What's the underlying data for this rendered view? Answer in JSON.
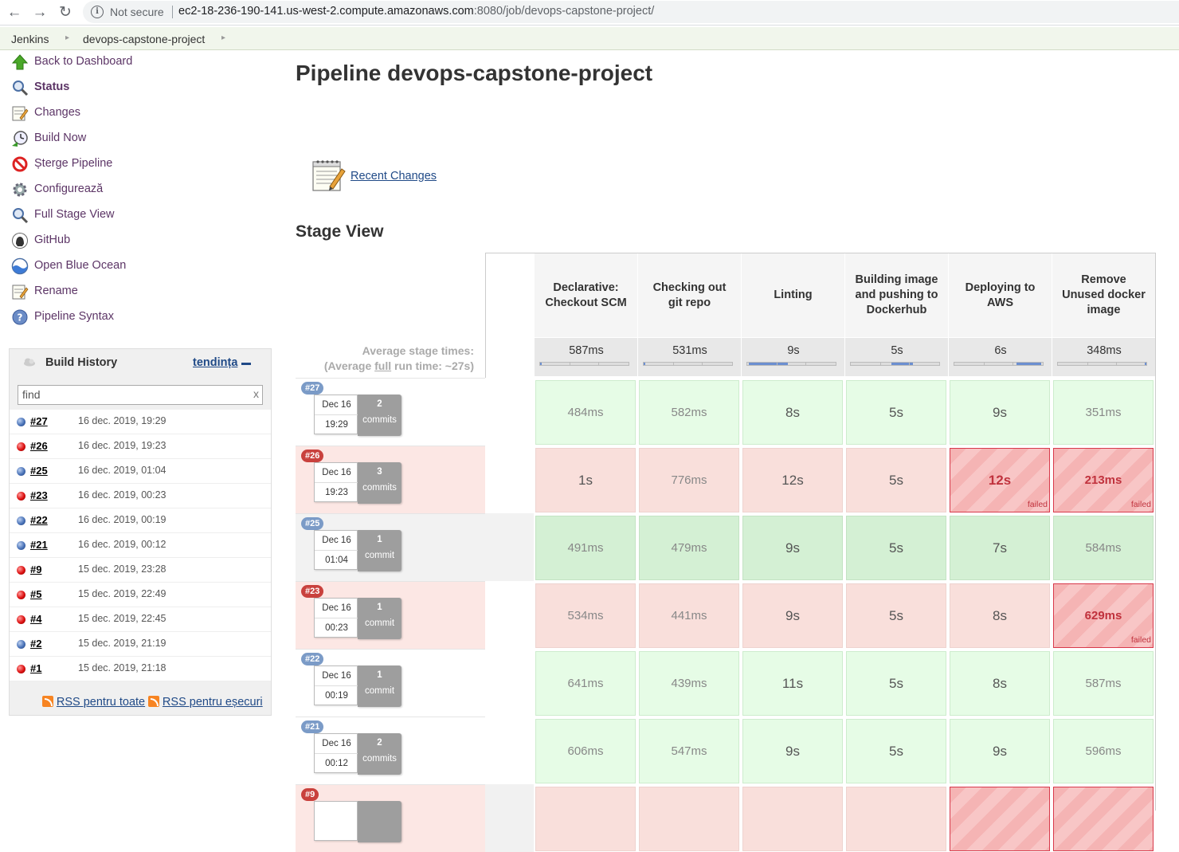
{
  "browser": {
    "security_label": "Not secure",
    "url_host": "ec2-18-236-190-141.us-west-2.compute.amazonaws.com",
    "url_rest": ":8080/job/devops-capstone-project/"
  },
  "breadcrumb": {
    "items": [
      "Jenkins",
      "devops-capstone-project"
    ]
  },
  "sidebar": {
    "tasks": [
      {
        "label": "Back to Dashboard",
        "icon": "up-arrow-icon"
      },
      {
        "label": "Status",
        "icon": "search-icon"
      },
      {
        "label": "Changes",
        "icon": "notepad-icon"
      },
      {
        "label": "Build Now",
        "icon": "clock-icon"
      },
      {
        "label": "Șterge Pipeline",
        "icon": "no-entry-icon"
      },
      {
        "label": "Configurează",
        "icon": "gear-icon"
      },
      {
        "label": "Full Stage View",
        "icon": "search-icon"
      },
      {
        "label": "GitHub",
        "icon": "github-icon"
      },
      {
        "label": "Open Blue Ocean",
        "icon": "blue-ocean-icon"
      },
      {
        "label": "Rename",
        "icon": "notepad-icon"
      },
      {
        "label": "Pipeline Syntax",
        "icon": "help-icon"
      }
    ]
  },
  "build_history": {
    "title": "Build History",
    "trend_label": "tendința",
    "filter_placeholder": "find",
    "clear_label": "x",
    "builds": [
      {
        "number": "#27",
        "date": "16 dec. 2019, 19:29",
        "status": "blue"
      },
      {
        "number": "#26",
        "date": "16 dec. 2019, 19:23",
        "status": "red"
      },
      {
        "number": "#25",
        "date": "16 dec. 2019, 01:04",
        "status": "blue"
      },
      {
        "number": "#23",
        "date": "16 dec. 2019, 00:23",
        "status": "red"
      },
      {
        "number": "#22",
        "date": "16 dec. 2019, 00:19",
        "status": "blue"
      },
      {
        "number": "#21",
        "date": "16 dec. 2019, 00:12",
        "status": "blue"
      },
      {
        "number": "#9",
        "date": "15 dec. 2019, 23:28",
        "status": "red"
      },
      {
        "number": "#5",
        "date": "15 dec. 2019, 22:49",
        "status": "red"
      },
      {
        "number": "#4",
        "date": "15 dec. 2019, 22:45",
        "status": "red"
      },
      {
        "number": "#2",
        "date": "15 dec. 2019, 21:19",
        "status": "blue"
      },
      {
        "number": "#1",
        "date": "15 dec. 2019, 21:18",
        "status": "red"
      }
    ],
    "rss_all": "RSS pentru toate",
    "rss_failures": "RSS pentru eșecuri"
  },
  "main": {
    "title": "Pipeline devops-capstone-project",
    "recent_changes": "Recent Changes",
    "stage_view_title": "Stage View",
    "avg_label_line1": "Average stage times:",
    "avg_label_line2_pre": "(Average ",
    "avg_label_line2_full": "full",
    "avg_label_line2_post": " run time: ~27s)"
  },
  "stage_view": {
    "stages": [
      {
        "name": "Declarative: Checkout SCM",
        "avg": "587ms",
        "avg_fill": [
          0.0,
          0.02
        ]
      },
      {
        "name": "Checking out git repo",
        "avg": "531ms",
        "avg_fill": [
          0.0,
          0.02
        ]
      },
      {
        "name": "Linting",
        "avg": "9s",
        "avg_fill": [
          0.02,
          0.46
        ]
      },
      {
        "name": "Building image and pushing to Dockerhub",
        "avg": "5s",
        "avg_fill": [
          0.46,
          0.7
        ]
      },
      {
        "name": "Deploying to AWS",
        "avg": "6s",
        "avg_fill": [
          0.7,
          0.98
        ]
      },
      {
        "name": "Remove Unused docker image",
        "avg": "348ms",
        "avg_fill": [
          0.98,
          1.0
        ]
      }
    ],
    "runs": [
      {
        "badge": "#27",
        "result": "success",
        "date": "Dec 16",
        "time": "19:29",
        "commits": "2",
        "commit_label": "commits",
        "cells": [
          {
            "v": "484ms",
            "s": "ok"
          },
          {
            "v": "582ms",
            "s": "ok"
          },
          {
            "v": "8s",
            "s": "ok"
          },
          {
            "v": "5s",
            "s": "ok"
          },
          {
            "v": "9s",
            "s": "ok"
          },
          {
            "v": "351ms",
            "s": "ok"
          }
        ]
      },
      {
        "badge": "#26",
        "result": "failed",
        "date": "Dec 16",
        "time": "19:23",
        "commits": "3",
        "commit_label": "commits",
        "cells": [
          {
            "v": "1s",
            "s": "warn"
          },
          {
            "v": "776ms",
            "s": "warn"
          },
          {
            "v": "12s",
            "s": "warn"
          },
          {
            "v": "5s",
            "s": "warn"
          },
          {
            "v": "12s",
            "s": "fail"
          },
          {
            "v": "213ms",
            "s": "fail"
          }
        ]
      },
      {
        "badge": "#25",
        "result": "success",
        "date": "Dec 16",
        "time": "01:04",
        "commits": "1",
        "commit_label": "commit",
        "cells": [
          {
            "v": "491ms",
            "s": "okdim"
          },
          {
            "v": "479ms",
            "s": "okdim"
          },
          {
            "v": "9s",
            "s": "okdim"
          },
          {
            "v": "5s",
            "s": "okdim"
          },
          {
            "v": "7s",
            "s": "okdim"
          },
          {
            "v": "584ms",
            "s": "okdim"
          }
        ]
      },
      {
        "badge": "#23",
        "result": "failed",
        "date": "Dec 16",
        "time": "00:23",
        "commits": "1",
        "commit_label": "commit",
        "cells": [
          {
            "v": "534ms",
            "s": "warn"
          },
          {
            "v": "441ms",
            "s": "warn"
          },
          {
            "v": "9s",
            "s": "warn"
          },
          {
            "v": "5s",
            "s": "warn"
          },
          {
            "v": "8s",
            "s": "warn"
          },
          {
            "v": "629ms",
            "s": "fail"
          }
        ]
      },
      {
        "badge": "#22",
        "result": "success",
        "date": "Dec 16",
        "time": "00:19",
        "commits": "1",
        "commit_label": "commit",
        "cells": [
          {
            "v": "641ms",
            "s": "ok"
          },
          {
            "v": "439ms",
            "s": "ok"
          },
          {
            "v": "11s",
            "s": "ok"
          },
          {
            "v": "5s",
            "s": "ok"
          },
          {
            "v": "8s",
            "s": "ok"
          },
          {
            "v": "587ms",
            "s": "ok"
          }
        ]
      },
      {
        "badge": "#21",
        "result": "success",
        "date": "Dec 16",
        "time": "00:12",
        "commits": "2",
        "commit_label": "commits",
        "cells": [
          {
            "v": "606ms",
            "s": "ok"
          },
          {
            "v": "547ms",
            "s": "ok"
          },
          {
            "v": "9s",
            "s": "ok"
          },
          {
            "v": "5s",
            "s": "ok"
          },
          {
            "v": "9s",
            "s": "ok"
          },
          {
            "v": "596ms",
            "s": "ok"
          }
        ]
      },
      {
        "badge": "#9",
        "result": "failed",
        "date": "",
        "time": "",
        "commits": "",
        "commit_label": "",
        "cells": [
          {
            "v": "",
            "s": "warn"
          },
          {
            "v": "",
            "s": "warn"
          },
          {
            "v": "",
            "s": "warn"
          },
          {
            "v": "",
            "s": "warn"
          },
          {
            "v": "",
            "s": "fail"
          },
          {
            "v": "",
            "s": "fail"
          }
        ]
      }
    ],
    "failed_label": "failed"
  },
  "colors": {
    "link": "#5c3566",
    "success_cell": "#e6fce6",
    "failed_cell": "#f5b4b4",
    "unstable_row": "#fce7e4"
  }
}
